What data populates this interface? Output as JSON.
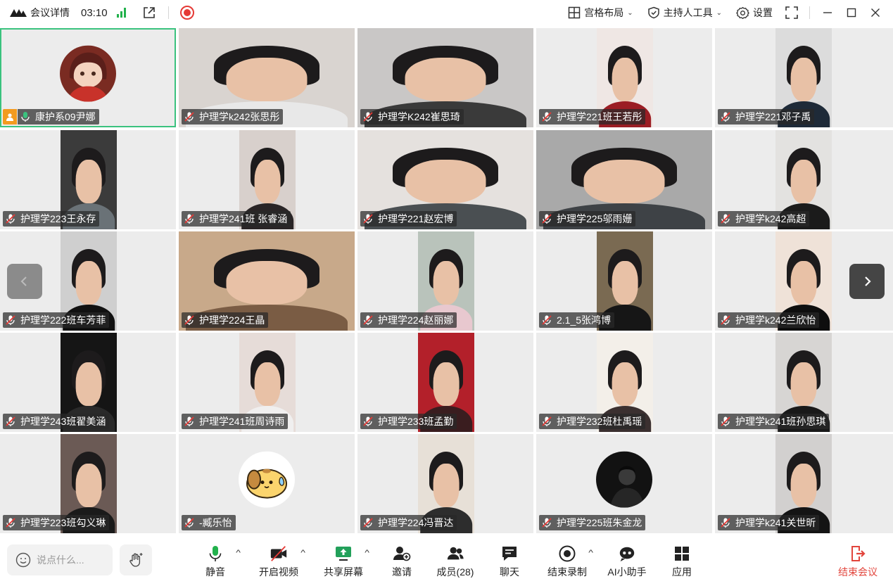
{
  "topbar": {
    "meeting_title": "会议详情",
    "timer": "03:10",
    "layout_label": "宫格布局",
    "host_tools_label": "主持人工具",
    "settings_label": "设置"
  },
  "colors": {
    "accent_green": "#22b14c",
    "record_red": "#e53935",
    "active_border": "#3ac27e",
    "host_badge": "#f39b1f",
    "end_red": "#e2453c"
  },
  "participants": [
    {
      "name": "康护系09尹娜",
      "host": true,
      "active": true,
      "kind": "avatar"
    },
    {
      "name": "护理学k242张思彤",
      "kind": "video"
    },
    {
      "name": "护理学K242崔思琦",
      "kind": "video"
    },
    {
      "name": "护理学221班王若彤",
      "kind": "video"
    },
    {
      "name": "护理学221邓子禹",
      "kind": "video"
    },
    {
      "name": "护理学223王永存",
      "kind": "video"
    },
    {
      "name": "护理学241班 张睿涵",
      "kind": "video"
    },
    {
      "name": "护理学221赵宏博",
      "kind": "video"
    },
    {
      "name": "护理学225邬雨姗",
      "kind": "video"
    },
    {
      "name": "护理学k242高超",
      "kind": "video"
    },
    {
      "name": "护理学222班车芳菲",
      "kind": "video"
    },
    {
      "name": "护理学224王晶",
      "kind": "video"
    },
    {
      "name": "护理学224赵丽娜",
      "kind": "video"
    },
    {
      "name": "2.1_5张鸿博",
      "kind": "video"
    },
    {
      "name": "护理学k242兰欣怡",
      "kind": "video"
    },
    {
      "name": "护理学243班翟美涵",
      "kind": "video"
    },
    {
      "name": "护理学241班周诗雨",
      "kind": "video"
    },
    {
      "name": "护理学233班孟勤",
      "kind": "video"
    },
    {
      "name": "护理学232班杜禹瑶",
      "kind": "video"
    },
    {
      "name": "护理学k241班孙思琪",
      "kind": "video"
    },
    {
      "name": "护理学223班勾义琳",
      "kind": "video"
    },
    {
      "name": "-臧乐怡",
      "kind": "avatar"
    },
    {
      "name": "护理学224冯晋达",
      "kind": "video"
    },
    {
      "name": "护理学225班朱金龙",
      "kind": "avatar"
    },
    {
      "name": "护理学k241关世昕",
      "kind": "video"
    }
  ],
  "toolbar": {
    "chat_placeholder": "说点什么...",
    "mute_label": "静音",
    "video_label": "开启视频",
    "share_label": "共享屏幕",
    "invite_label": "邀请",
    "members_label": "成员(28)",
    "chat_label": "聊天",
    "record_label": "结束录制",
    "ai_label": "AI小助手",
    "apps_label": "应用",
    "end_label": "结束会议"
  }
}
